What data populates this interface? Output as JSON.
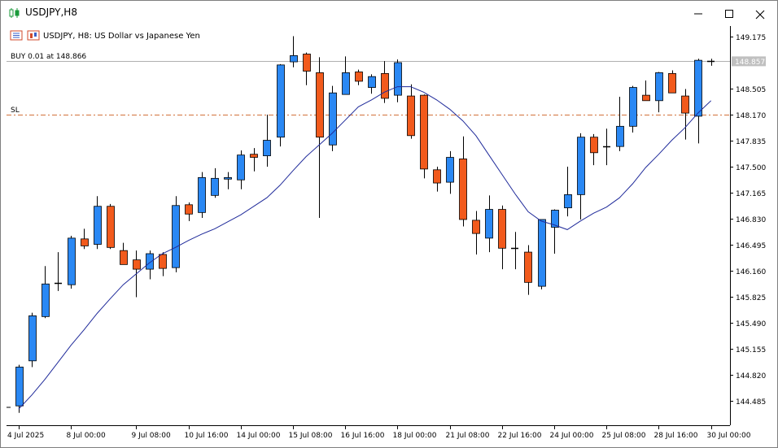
{
  "window": {
    "title": "USDJPY,H8",
    "minimize_icon": "minimize-icon",
    "maximize_icon": "maximize-icon",
    "close_icon": "close-icon"
  },
  "chart_header": {
    "symbol_info": "USDJPY, H8:  US Dollar vs Japanese Yen",
    "position_label": "BUY 0.01 at 148.866",
    "sl_label": "SL",
    "current_price_label": "148.857"
  },
  "colors": {
    "bull": "#2a88f4",
    "bear": "#f25a1c",
    "wick": "#000000",
    "ma": "#1f2a9a",
    "sl_line": "#d2703a",
    "position_line": "#b0b0b0",
    "price_tag_bg": "#c0c0c0"
  },
  "chart_data": {
    "type": "candlestick",
    "symbol": "USDJPY",
    "timeframe": "H8",
    "y_range": [
      144.2,
      149.35
    ],
    "y_ticks": [
      "149.175",
      "148.505",
      "148.170",
      "147.835",
      "147.500",
      "147.165",
      "146.830",
      "146.495",
      "146.160",
      "145.825",
      "145.490",
      "145.155",
      "144.820",
      "144.485"
    ],
    "x_tick_labels": [
      "4 Jul 2025",
      "8 Jul 00:00",
      "9 Jul 08:00",
      "10 Jul 16:00",
      "14 Jul 00:00",
      "15 Jul 08:00",
      "16 Jul 16:00",
      "18 Jul 00:00",
      "21 Jul 08:00",
      "22 Jul 16:00",
      "24 Jul 00:00",
      "25 Jul 08:00",
      "28 Jul 16:00",
      "30 Jul 00:00"
    ],
    "x_tick_candle_index": [
      0,
      4,
      9,
      13,
      17,
      21,
      25,
      29,
      33,
      37,
      41,
      45,
      49,
      53
    ],
    "position_price": 148.866,
    "stop_loss": 148.17,
    "current_price": 148.857,
    "candles": [
      {
        "o": 144.42,
        "h": 144.95,
        "l": 144.33,
        "c": 144.92
      },
      {
        "o": 145.0,
        "h": 145.62,
        "l": 144.92,
        "c": 145.58
      },
      {
        "o": 145.57,
        "h": 146.22,
        "l": 145.55,
        "c": 145.99
      },
      {
        "o": 145.99,
        "h": 146.4,
        "l": 145.9,
        "c": 146.0
      },
      {
        "o": 145.98,
        "h": 146.61,
        "l": 145.93,
        "c": 146.58
      },
      {
        "o": 146.57,
        "h": 146.7,
        "l": 146.44,
        "c": 146.48
      },
      {
        "o": 146.5,
        "h": 147.12,
        "l": 146.44,
        "c": 146.99
      },
      {
        "o": 146.99,
        "h": 147.02,
        "l": 146.44,
        "c": 146.46
      },
      {
        "o": 146.42,
        "h": 146.52,
        "l": 146.26,
        "c": 146.24
      },
      {
        "o": 146.3,
        "h": 146.42,
        "l": 145.82,
        "c": 146.18
      },
      {
        "o": 146.18,
        "h": 146.42,
        "l": 146.05,
        "c": 146.38
      },
      {
        "o": 146.37,
        "h": 146.4,
        "l": 146.09,
        "c": 146.19
      },
      {
        "o": 146.2,
        "h": 147.12,
        "l": 146.14,
        "c": 147.0
      },
      {
        "o": 147.01,
        "h": 147.04,
        "l": 146.8,
        "c": 146.89
      },
      {
        "o": 146.91,
        "h": 147.43,
        "l": 146.84,
        "c": 147.36
      },
      {
        "o": 147.13,
        "h": 147.48,
        "l": 147.1,
        "c": 147.35
      },
      {
        "o": 147.34,
        "h": 147.43,
        "l": 147.21,
        "c": 147.36
      },
      {
        "o": 147.33,
        "h": 147.71,
        "l": 147.21,
        "c": 147.65
      },
      {
        "o": 147.66,
        "h": 147.74,
        "l": 147.44,
        "c": 147.62
      },
      {
        "o": 147.64,
        "h": 148.17,
        "l": 147.5,
        "c": 147.84
      },
      {
        "o": 147.88,
        "h": 148.82,
        "l": 147.76,
        "c": 148.81
      },
      {
        "o": 148.85,
        "h": 149.18,
        "l": 148.78,
        "c": 148.93
      },
      {
        "o": 148.95,
        "h": 148.97,
        "l": 148.55,
        "c": 148.73
      },
      {
        "o": 148.71,
        "h": 148.91,
        "l": 146.84,
        "c": 147.88
      },
      {
        "o": 147.78,
        "h": 148.54,
        "l": 147.7,
        "c": 148.45
      },
      {
        "o": 148.43,
        "h": 148.92,
        "l": 148.43,
        "c": 148.71
      },
      {
        "o": 148.72,
        "h": 148.75,
        "l": 148.55,
        "c": 148.6
      },
      {
        "o": 148.52,
        "h": 148.69,
        "l": 148.44,
        "c": 148.66
      },
      {
        "o": 148.7,
        "h": 148.86,
        "l": 148.32,
        "c": 148.38
      },
      {
        "o": 148.42,
        "h": 148.88,
        "l": 148.33,
        "c": 148.84
      },
      {
        "o": 148.41,
        "h": 148.56,
        "l": 147.86,
        "c": 147.9
      },
      {
        "o": 148.42,
        "h": 148.43,
        "l": 147.35,
        "c": 147.47
      },
      {
        "o": 147.46,
        "h": 147.5,
        "l": 147.18,
        "c": 147.29
      },
      {
        "o": 147.3,
        "h": 147.7,
        "l": 147.15,
        "c": 147.62
      },
      {
        "o": 147.6,
        "h": 147.89,
        "l": 146.73,
        "c": 146.82
      },
      {
        "o": 146.81,
        "h": 146.93,
        "l": 146.37,
        "c": 146.64
      },
      {
        "o": 146.58,
        "h": 147.13,
        "l": 146.4,
        "c": 146.95
      },
      {
        "o": 146.95,
        "h": 147.0,
        "l": 146.18,
        "c": 146.45
      },
      {
        "o": 146.45,
        "h": 146.66,
        "l": 146.18,
        "c": 146.45
      },
      {
        "o": 146.4,
        "h": 146.49,
        "l": 145.85,
        "c": 146.01
      },
      {
        "o": 145.96,
        "h": 146.82,
        "l": 145.92,
        "c": 146.82
      },
      {
        "o": 146.72,
        "h": 146.95,
        "l": 146.38,
        "c": 146.94
      },
      {
        "o": 146.97,
        "h": 147.5,
        "l": 146.86,
        "c": 147.14
      },
      {
        "o": 147.14,
        "h": 147.93,
        "l": 146.82,
        "c": 147.88
      },
      {
        "o": 147.88,
        "h": 147.92,
        "l": 147.52,
        "c": 147.68
      },
      {
        "o": 147.75,
        "h": 147.99,
        "l": 147.52,
        "c": 147.76
      },
      {
        "o": 147.76,
        "h": 148.4,
        "l": 147.7,
        "c": 148.02
      },
      {
        "o": 148.02,
        "h": 148.54,
        "l": 147.94,
        "c": 148.52
      },
      {
        "o": 148.42,
        "h": 148.61,
        "l": 148.35,
        "c": 148.35
      },
      {
        "o": 148.35,
        "h": 148.72,
        "l": 148.2,
        "c": 148.71
      },
      {
        "o": 148.7,
        "h": 148.74,
        "l": 148.45,
        "c": 148.45
      },
      {
        "o": 148.41,
        "h": 148.5,
        "l": 147.85,
        "c": 148.19
      },
      {
        "o": 148.15,
        "h": 148.89,
        "l": 147.8,
        "c": 148.87
      },
      {
        "o": 148.85,
        "h": 148.89,
        "l": 148.8,
        "c": 148.86
      }
    ],
    "ma": [
      144.38,
      144.56,
      144.76,
      144.98,
      145.2,
      145.4,
      145.61,
      145.8,
      145.98,
      146.12,
      146.26,
      146.38,
      146.46,
      146.55,
      146.63,
      146.7,
      146.79,
      146.88,
      146.99,
      147.1,
      147.26,
      147.45,
      147.63,
      147.78,
      147.93,
      148.1,
      148.27,
      148.36,
      148.46,
      148.53,
      148.53,
      148.46,
      148.36,
      148.24,
      148.09,
      147.9,
      147.65,
      147.4,
      147.15,
      146.92,
      146.8,
      146.75,
      146.69,
      146.8,
      146.9,
      146.98,
      147.1,
      147.28,
      147.49,
      147.66,
      147.84,
      148.0,
      148.19,
      148.35
    ]
  }
}
